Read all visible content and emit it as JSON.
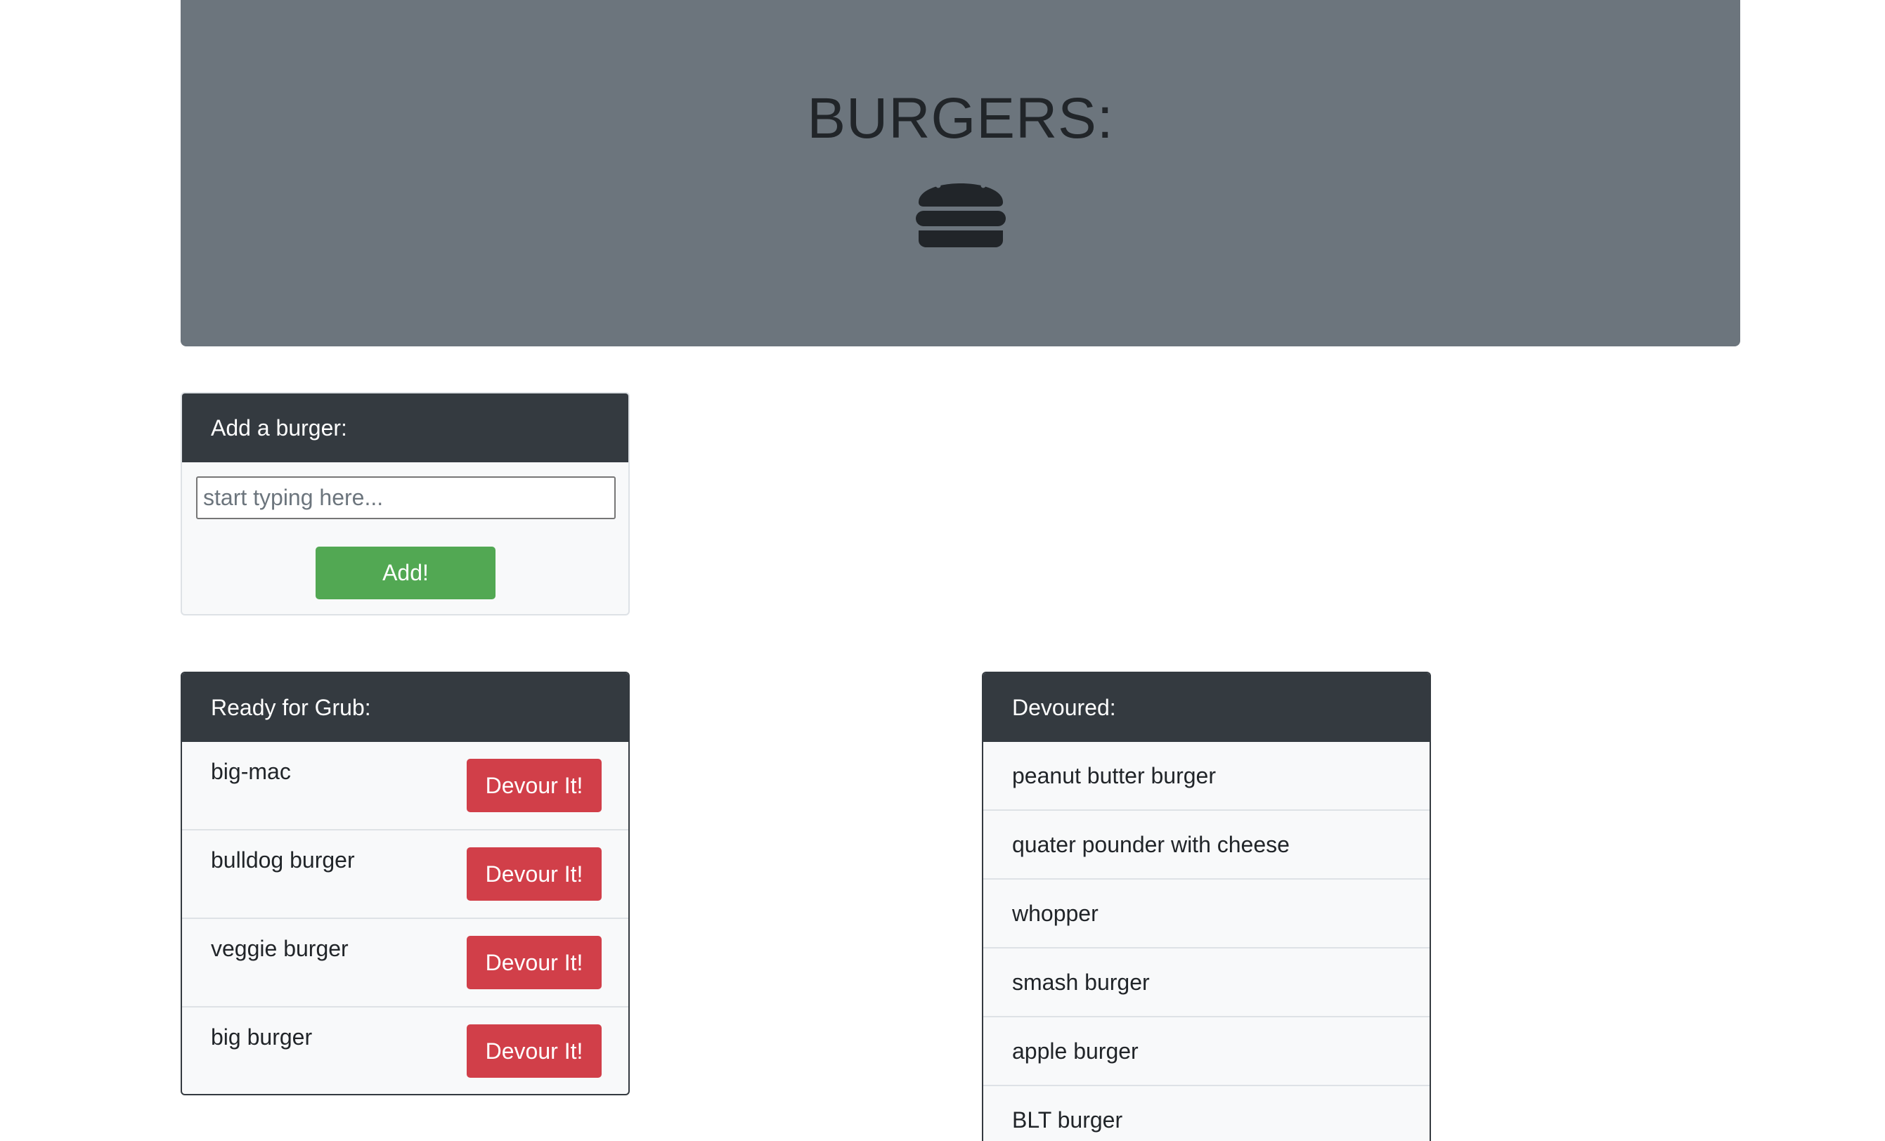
{
  "header": {
    "title": "BURGERS:",
    "icon": "burger-icon"
  },
  "add_card": {
    "title": "Add a burger:",
    "input_placeholder": "start typing here...",
    "input_value": "",
    "button_label": "Add!"
  },
  "ready_card": {
    "title": "Ready for Grub:",
    "items": [
      {
        "name": "big-mac",
        "button_label": "Devour It!"
      },
      {
        "name": "bulldog burger",
        "button_label": "Devour It!"
      },
      {
        "name": "veggie burger",
        "button_label": "Devour It!"
      },
      {
        "name": "big burger",
        "button_label": "Devour It!"
      }
    ]
  },
  "devoured_card": {
    "title": "Devoured:",
    "items": [
      "peanut butter burger",
      "quater pounder with cheese",
      "whopper",
      "smash burger",
      "apple burger",
      "BLT burger"
    ]
  },
  "colors": {
    "jumbotron": "#6c757d",
    "card_header": "#343a40",
    "add_button": "#52a853",
    "devour_button": "#d13f49",
    "card_body": "#f8f9fa"
  }
}
